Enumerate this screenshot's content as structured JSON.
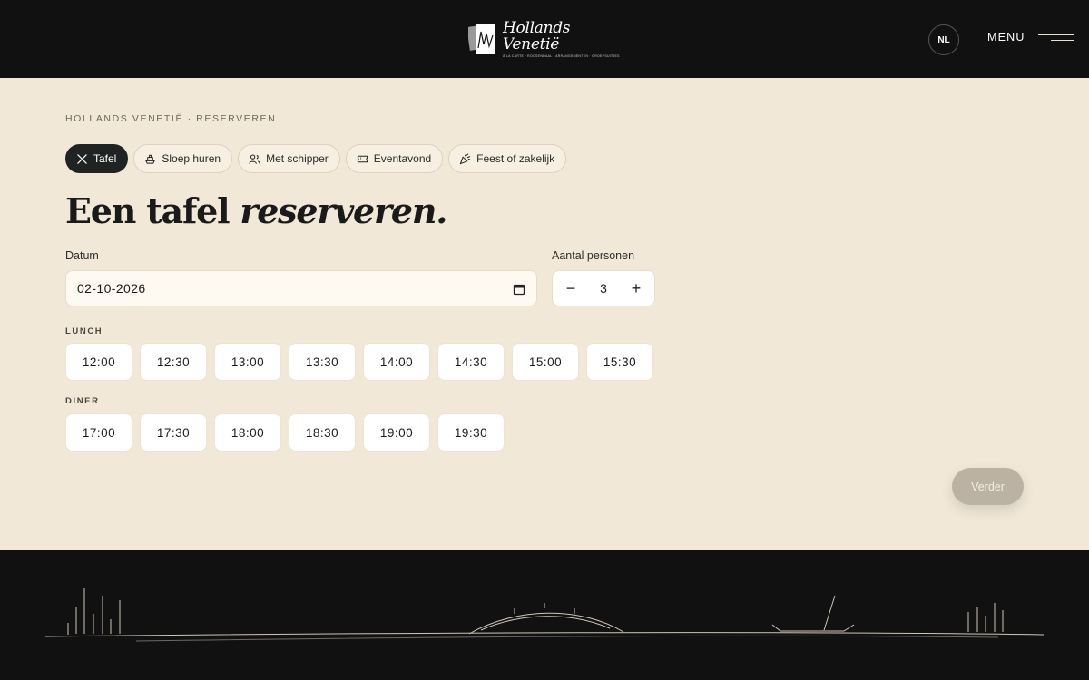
{
  "header": {
    "logo_name": "Hollands Venetië",
    "logo_tagline": "À LA CARTE · ROOSENDAAL · ARRANGEMENTEN · GROEPSUITJES",
    "lang": "NL",
    "menu_label": "MENU"
  },
  "breadcrumb": "HOLLANDS VENETIË · RESERVEREN",
  "tabs": [
    {
      "label": "Tafel",
      "icon": "cutlery-icon",
      "active": true
    },
    {
      "label": "Sloep huren",
      "icon": "boat-icon",
      "active": false
    },
    {
      "label": "Met schipper",
      "icon": "people-icon",
      "active": false
    },
    {
      "label": "Eventavond",
      "icon": "ticket-icon",
      "active": false
    },
    {
      "label": "Feest of zakelijk",
      "icon": "party-icon",
      "active": false
    }
  ],
  "title": {
    "plain": "Een tafel ",
    "italic": "reserveren."
  },
  "form": {
    "date_label": "Datum",
    "date_value": "02-10-2026",
    "persons_label": "Aantal personen",
    "persons_value": "3",
    "minus": "−",
    "plus": "+"
  },
  "lunch": {
    "label": "LUNCH",
    "slots": [
      "12:00",
      "12:30",
      "13:00",
      "13:30",
      "14:00",
      "14:30",
      "15:00",
      "15:30"
    ]
  },
  "dinner": {
    "label": "DINER",
    "slots": [
      "17:00",
      "17:30",
      "18:00",
      "18:30",
      "19:00",
      "19:30"
    ]
  },
  "next_label": "Verder",
  "colors": {
    "accent_dark": "#1f2321",
    "panel": "#f1e8d8",
    "header_bg": "#111111",
    "disabled_btn": "#bbb2a4"
  }
}
